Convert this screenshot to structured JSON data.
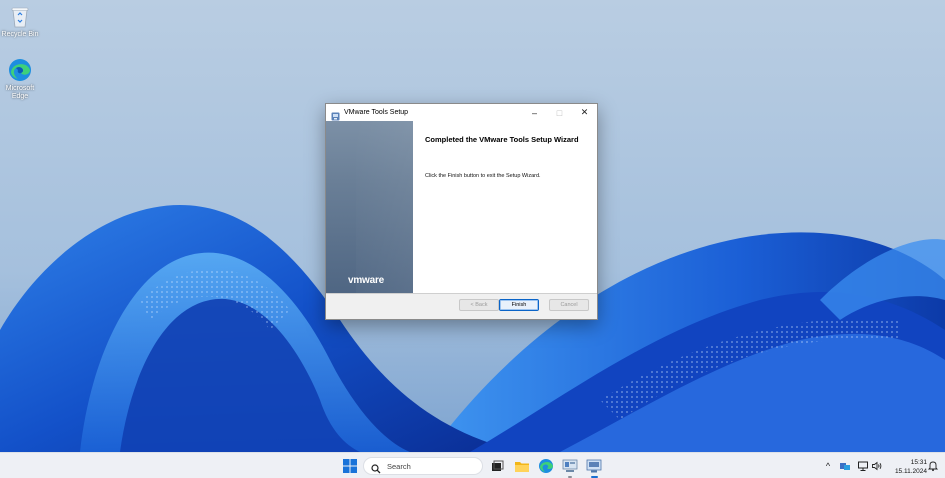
{
  "desktop": {
    "icons": [
      {
        "label": "Recycle Bin",
        "icon": "recycle-bin-icon"
      },
      {
        "label": "Microsoft Edge",
        "icon": "edge-icon"
      }
    ]
  },
  "dialog": {
    "title": "VMware Tools Setup",
    "heading": "Completed the VMware Tools Setup Wizard",
    "message": "Click the Finish button to exit the Setup Wizard.",
    "brand": "vmware",
    "buttons": {
      "back": "< Back",
      "finish": "Finish",
      "cancel": "Cancel"
    },
    "window_controls": {
      "minimize": "–",
      "maximize": "□",
      "close": "✕"
    }
  },
  "taskbar": {
    "search_placeholder": "Search",
    "apps": [
      "start-icon",
      "task-view-icon",
      "file-explorer-icon",
      "edge-icon",
      "server-manager-icon",
      "vmware-setup-icon"
    ],
    "tray": {
      "chevron": "^",
      "time": "15:31",
      "date": "15.11.2024"
    }
  },
  "colors": {
    "accent": "#0a64c8",
    "banner": "#5a6f8c",
    "taskbar": "#eef0f5"
  }
}
